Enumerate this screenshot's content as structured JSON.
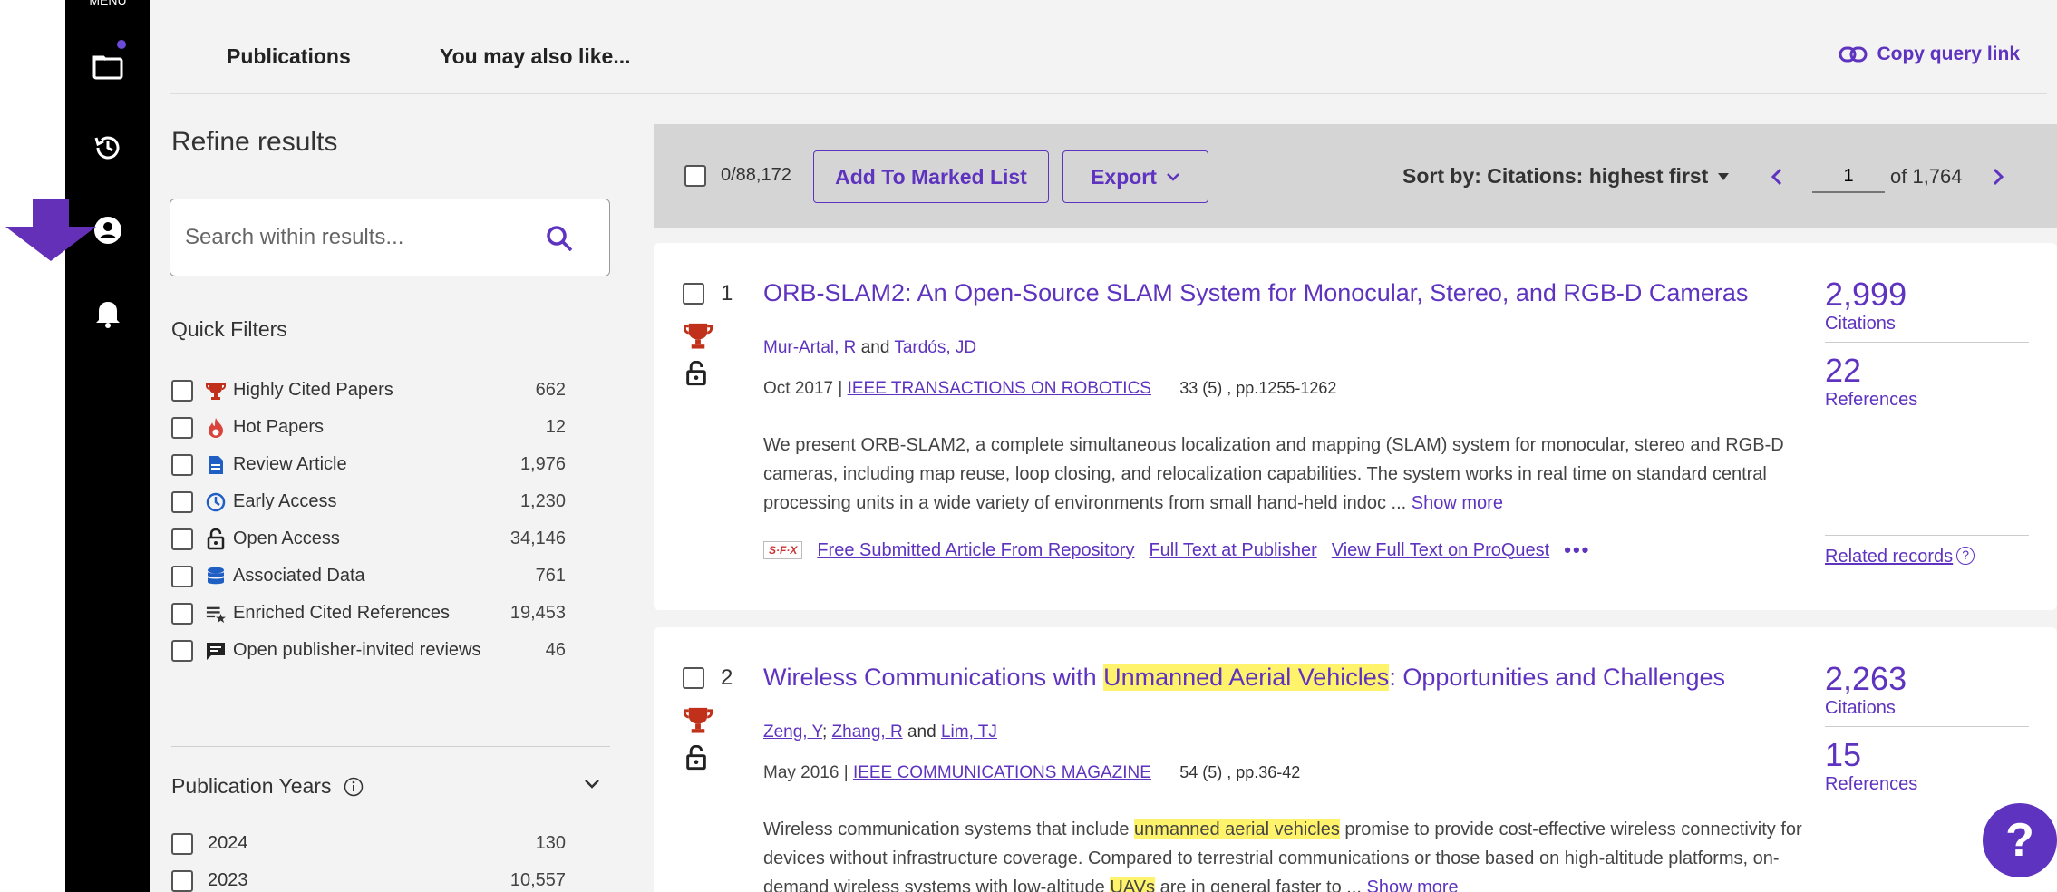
{
  "rail": {
    "menu_label": "MENU"
  },
  "tabs": {
    "publications": "Publications",
    "also_like": "You may also like..."
  },
  "copy_link": "Copy query link",
  "sidebar": {
    "refine_title": "Refine results",
    "search_placeholder": "Search within results...",
    "quick_filters_title": "Quick Filters",
    "quick_filters": [
      {
        "label": "Highly Cited Papers",
        "count": "662",
        "icon": "trophy-icon"
      },
      {
        "label": "Hot Papers",
        "count": "12",
        "icon": "flame-icon"
      },
      {
        "label": "Review Article",
        "count": "1,976",
        "icon": "document-icon"
      },
      {
        "label": "Early Access",
        "count": "1,230",
        "icon": "clock-icon"
      },
      {
        "label": "Open Access",
        "count": "34,146",
        "icon": "unlock-icon"
      },
      {
        "label": "Associated Data",
        "count": "761",
        "icon": "database-icon"
      },
      {
        "label": "Enriched Cited References",
        "count": "19,453",
        "icon": "list-star-icon"
      },
      {
        "label": "Open publisher-invited reviews",
        "count": "46",
        "icon": "review-icon"
      }
    ],
    "pub_years_title": "Publication Years",
    "pub_years": [
      {
        "label": "2024",
        "count": "130"
      },
      {
        "label": "2023",
        "count": "10,557"
      }
    ]
  },
  "toolbar": {
    "selected_count": "0/88,172",
    "add_marked": "Add To Marked List",
    "export": "Export",
    "sort_by": "Sort by: Citations: highest first",
    "page_value": "1",
    "page_of": "of 1,764"
  },
  "results": [
    {
      "num": "1",
      "title": "ORB-SLAM2: An Open-Source SLAM System for Monocular, Stereo, and RGB-D Cameras",
      "author1": "Mur-Artal, R",
      "author_and": "and",
      "author2": "Tardós, JD",
      "date": "Oct 2017 |",
      "journal": "IEEE TRANSACTIONS ON ROBOTICS",
      "volume": "33 (5) , pp.1255-1262",
      "abstract": "We present ORB-SLAM2, a complete simultaneous localization and mapping (SLAM) system for monocular, stereo and RGB-D cameras, including map reuse, loop closing, and relocalization capabilities. The system works in real time on standard central processing units in a wide variety of environments from small hand-held indoc ...",
      "show_more": "Show more",
      "sfx": "S·F·X",
      "link1": "Free Submitted Article From Repository",
      "link2": "Full Text at Publisher",
      "link3": "View Full Text on ProQuest",
      "citations": "2,999",
      "citations_label": "Citations",
      "references": "22",
      "references_label": "References",
      "related": "Related records"
    },
    {
      "num": "2",
      "title_pre": "Wireless Communications with ",
      "title_hl": "Unmanned Aerial Vehicles",
      "title_post": ": Opportunities and Challenges",
      "author1": "Zeng, Y",
      "author_sep": ";",
      "author2": "Zhang, R",
      "author_and": "and",
      "author3": "Lim, TJ",
      "date": "May 2016 |",
      "journal": "IEEE COMMUNICATIONS MAGAZINE",
      "volume": "54 (5) , pp.36-42",
      "abs1": "Wireless communication systems that include ",
      "abs_hl1": "unmanned aerial vehicles",
      "abs2": " promise to provide cost-effective wireless connectivity for devices without infrastructure coverage. Compared to terrestrial communications or those based on high-altitude platforms, on-demand wireless systems with low-altitude ",
      "abs_hl2": "UAVs",
      "abs3": " are in general faster to ...",
      "show_more": "Show more",
      "citations": "2,263",
      "citations_label": "Citations",
      "references": "15",
      "references_label": "References"
    }
  ],
  "help": "?"
}
